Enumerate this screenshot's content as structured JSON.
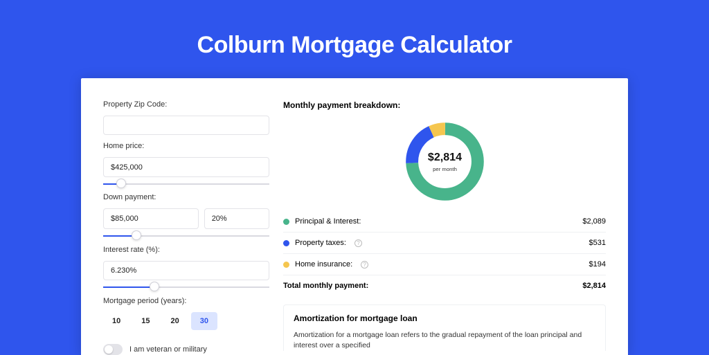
{
  "title": "Colburn Mortgage Calculator",
  "form": {
    "zip_label": "Property Zip Code:",
    "zip_value": "",
    "home_price_label": "Home price:",
    "home_price_value": "$425,000",
    "home_price_slider_pct": 11,
    "down_payment_label": "Down payment:",
    "down_payment_value": "$85,000",
    "down_payment_pct": "20%",
    "down_payment_slider_pct": 20,
    "rate_label": "Interest rate (%):",
    "rate_value": "6.230%",
    "rate_slider_pct": 31,
    "period_label": "Mortgage period (years):",
    "periods": [
      "10",
      "15",
      "20",
      "30"
    ],
    "period_active_index": 3,
    "veteran_label": "I am veteran or military"
  },
  "breakdown": {
    "title": "Monthly payment breakdown:",
    "center_value": "$2,814",
    "center_sub": "per month",
    "items": [
      {
        "label": "Principal & Interest:",
        "value": "$2,089",
        "color": "#48b48b"
      },
      {
        "label": "Property taxes:",
        "value": "$531",
        "color": "#2f55ed",
        "info": true
      },
      {
        "label": "Home insurance:",
        "value": "$194",
        "color": "#f5c64f",
        "info": true
      }
    ],
    "total_label": "Total monthly payment:",
    "total_value": "$2,814"
  },
  "amortization": {
    "heading": "Amortization for mortgage loan",
    "body": "Amortization for a mortgage loan refers to the gradual repayment of the loan principal and interest over a specified"
  },
  "chart_data": {
    "type": "pie",
    "title": "Monthly payment breakdown",
    "series": [
      {
        "name": "Principal & Interest",
        "value": 2089,
        "color": "#48b48b"
      },
      {
        "name": "Property taxes",
        "value": 531,
        "color": "#2f55ed"
      },
      {
        "name": "Home insurance",
        "value": 194,
        "color": "#f5c64f"
      }
    ],
    "total": 2814,
    "center_label": "per month"
  }
}
